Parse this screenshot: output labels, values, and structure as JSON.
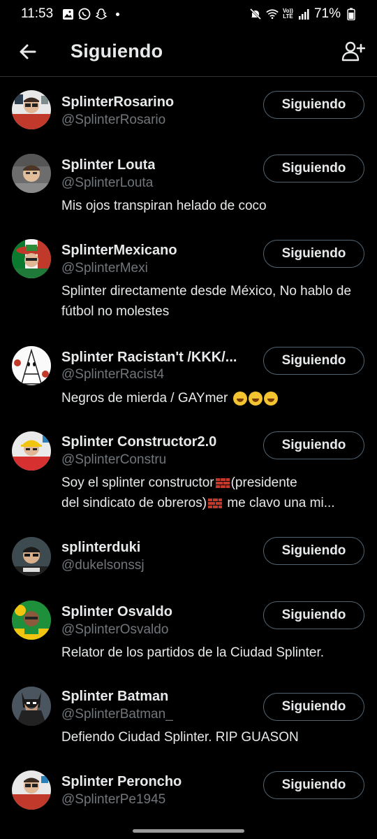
{
  "status_bar": {
    "time": "11:53",
    "battery": "71%",
    "volte_top": "Vo))",
    "volte_bottom": "LTE"
  },
  "header": {
    "title": "Siguiendo",
    "back_icon": "arrow-left-icon",
    "add_icon": "add-user-icon"
  },
  "accounts": [
    {
      "name": "SplinterRosarino",
      "handle": "@SplinterRosario",
      "bio": "",
      "button": "Siguiendo",
      "avatar_bg": "#c0392b"
    },
    {
      "name": "Splinter Louta",
      "handle": "@SplinterLouta",
      "bio": "Mis ojos transpiran helado de coco",
      "button": "Siguiendo",
      "avatar_bg": "#7f8c8d"
    },
    {
      "name": "SplinterMexicano",
      "handle": "@SplinterMexi",
      "bio": "Splinter directamente desde México, No hablo de fútbol no molestes",
      "button": "Siguiendo",
      "avatar_bg": "#2e8b3a"
    },
    {
      "name": "Splinter Racistan't /KKK/...",
      "handle": "@SplinterRacist4",
      "bio": "Negros de mierda / GAYmer",
      "button": "Siguiendo",
      "avatar_bg": "#ffffff"
    },
    {
      "name": "Splinter Constructor2.0",
      "handle": "@SplinterConstru",
      "bio_line1": "Soy el splinter constructor",
      "bio_line1b": "(presidente",
      "bio_line2": "del sindicato de obreros)",
      "bio_line2b": " me clavo una mi...",
      "button": "Siguiendo",
      "avatar_bg": "#d63031"
    },
    {
      "name": "splinterduki",
      "handle": "@dukelsonssj",
      "bio": "",
      "button": "Siguiendo",
      "avatar_bg": "#3d4a4f"
    },
    {
      "name": "Splinter Osvaldo",
      "handle": "@SplinterOsvaldo",
      "bio": "Relator de los partidos de la Ciudad Splinter.",
      "button": "Siguiendo",
      "avatar_bg": "#1e8f3a"
    },
    {
      "name": "Splinter Batman",
      "handle": "@SplinterBatman_",
      "bio": "Defiendo Ciudad Splinter. RIP GUASON",
      "button": "Siguiendo",
      "avatar_bg": "#2b2f36"
    },
    {
      "name": "Splinter Peroncho",
      "handle": "@SplinterPe1945",
      "bio": "",
      "button": "Siguiendo",
      "avatar_bg": "#c0392b"
    }
  ]
}
